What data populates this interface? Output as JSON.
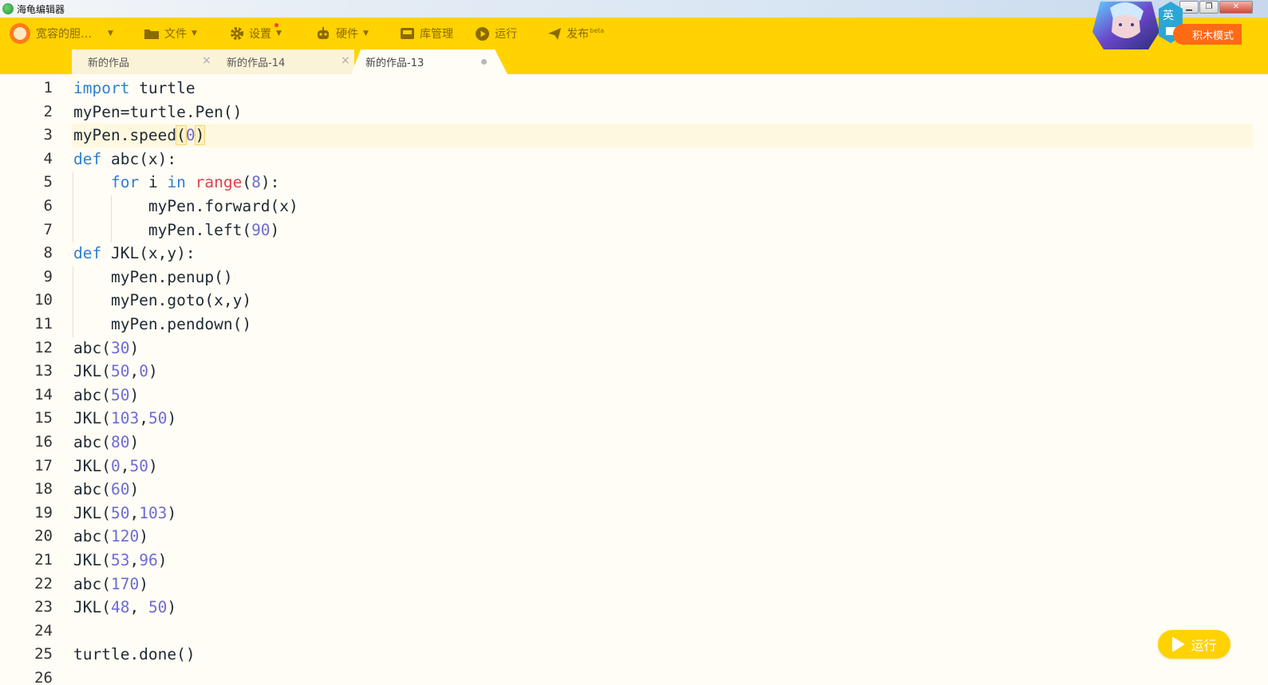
{
  "window": {
    "title": "海龟编辑器"
  },
  "toolbar": {
    "user": "宽容的胆…",
    "file": "文件",
    "settings": "设置",
    "hardware": "硬件",
    "library": "库管理",
    "run": "运行",
    "publish": "发布",
    "publish_badge": "beta",
    "lang_badge": "英",
    "mode_button": "积木模式"
  },
  "tabs": [
    {
      "label": "新的作品",
      "close": "×"
    },
    {
      "label": "新的作品-14",
      "close": "×"
    },
    {
      "label": "新的作品-13"
    }
  ],
  "editor": {
    "line_numbers": [
      "1",
      "2",
      "3",
      "4",
      "5",
      "6",
      "7",
      "8",
      "9",
      "10",
      "11",
      "12",
      "13",
      "14",
      "15",
      "16",
      "17",
      "18",
      "19",
      "20",
      "21",
      "22",
      "23",
      "24",
      "25",
      "26"
    ],
    "active_line": 3,
    "lines": [
      [
        [
          "kw",
          "import"
        ],
        [
          "t",
          " turtle"
        ]
      ],
      [
        [
          "t",
          "myPen=turtle.Pen()"
        ]
      ],
      [
        [
          "t",
          "myPen.speed"
        ],
        [
          "br",
          "("
        ],
        [
          "num",
          "0"
        ],
        [
          "br",
          ")"
        ]
      ],
      [
        [
          "kw",
          "def"
        ],
        [
          "t",
          " abc(x):"
        ]
      ],
      [
        [
          "t",
          "    "
        ],
        [
          "kw",
          "for"
        ],
        [
          "t",
          " i "
        ],
        [
          "kw",
          "in"
        ],
        [
          "t",
          " "
        ],
        [
          "bi",
          "range"
        ],
        [
          "t",
          "("
        ],
        [
          "num",
          "8"
        ],
        [
          "t",
          "):"
        ]
      ],
      [
        [
          "t",
          "        myPen.forward(x)"
        ]
      ],
      [
        [
          "t",
          "        myPen.left("
        ],
        [
          "num",
          "90"
        ],
        [
          "t",
          ")"
        ]
      ],
      [
        [
          "kw",
          "def"
        ],
        [
          "t",
          " JKL(x,y):"
        ]
      ],
      [
        [
          "t",
          "    myPen.penup()"
        ]
      ],
      [
        [
          "t",
          "    myPen.goto(x,y)"
        ]
      ],
      [
        [
          "t",
          "    myPen.pendown()"
        ]
      ],
      [
        [
          "t",
          "abc("
        ],
        [
          "num",
          "30"
        ],
        [
          "t",
          ")"
        ]
      ],
      [
        [
          "t",
          "JKL("
        ],
        [
          "num",
          "50"
        ],
        [
          "t",
          ","
        ],
        [
          "num",
          "0"
        ],
        [
          "t",
          ")"
        ]
      ],
      [
        [
          "t",
          "abc("
        ],
        [
          "num",
          "50"
        ],
        [
          "t",
          ")"
        ]
      ],
      [
        [
          "t",
          "JKL("
        ],
        [
          "num",
          "103"
        ],
        [
          "t",
          ","
        ],
        [
          "num",
          "50"
        ],
        [
          "t",
          ")"
        ]
      ],
      [
        [
          "t",
          "abc("
        ],
        [
          "num",
          "80"
        ],
        [
          "t",
          ")"
        ]
      ],
      [
        [
          "t",
          "JKL("
        ],
        [
          "num",
          "0"
        ],
        [
          "t",
          ","
        ],
        [
          "num",
          "50"
        ],
        [
          "t",
          ")"
        ]
      ],
      [
        [
          "t",
          "abc("
        ],
        [
          "num",
          "60"
        ],
        [
          "t",
          ")"
        ]
      ],
      [
        [
          "t",
          "JKL("
        ],
        [
          "num",
          "50"
        ],
        [
          "t",
          ","
        ],
        [
          "num",
          "103"
        ],
        [
          "t",
          ")"
        ]
      ],
      [
        [
          "t",
          "abc("
        ],
        [
          "num",
          "120"
        ],
        [
          "t",
          ")"
        ]
      ],
      [
        [
          "t",
          "JKL("
        ],
        [
          "num",
          "53"
        ],
        [
          "t",
          ","
        ],
        [
          "num",
          "96"
        ],
        [
          "t",
          ")"
        ]
      ],
      [
        [
          "t",
          "abc("
        ],
        [
          "num",
          "170"
        ],
        [
          "t",
          ")"
        ]
      ],
      [
        [
          "t",
          "JKL("
        ],
        [
          "num",
          "48"
        ],
        [
          "t",
          ", "
        ],
        [
          "num",
          "50"
        ],
        [
          "t",
          ")"
        ]
      ],
      [],
      [
        [
          "t",
          "turtle.done()"
        ]
      ],
      []
    ]
  },
  "run_button": {
    "label": "运行"
  },
  "colors": {
    "toolbar": "#ffd200",
    "keyword": "#2d7fd3",
    "number": "#6b6bd6",
    "builtin": "#e0414b",
    "mode_button": "#ff6a14"
  }
}
